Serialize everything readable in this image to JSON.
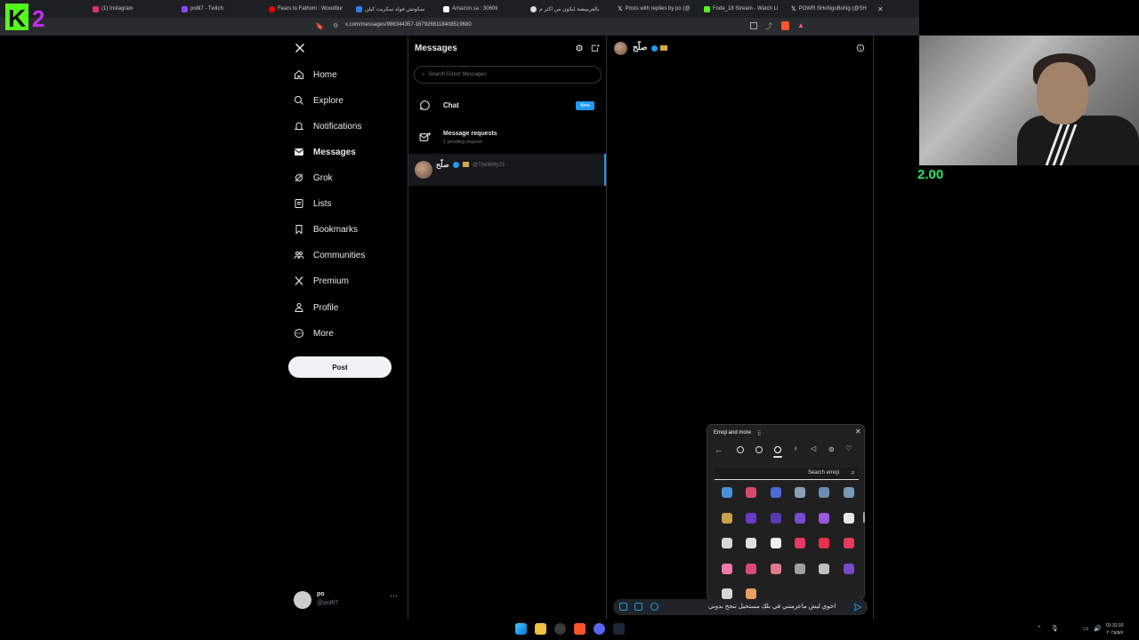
{
  "browser": {
    "tabs": [
      {
        "label": "instagra",
        "icon": "kick-icon"
      },
      {
        "label": "(1) Instagram",
        "icon": "instagram-icon"
      },
      {
        "label": "po8l7 - Twitch",
        "icon": "twitch-icon"
      },
      {
        "label": "Fears to Fathom : Woodbur",
        "icon": "youtube-icon"
      },
      {
        "label": "سكوتش فولد سكريت كيلن",
        "icon": "store-icon"
      },
      {
        "label": "Amazon.sa : 3060ti",
        "icon": "amazon-icon"
      },
      {
        "label": "بالعربيبضة لنكون من اكثر م",
        "icon": "google-icon"
      },
      {
        "label": "Posts with replies by po (@",
        "icon": "x-icon"
      },
      {
        "label": "Fode_18 Stream - Watch Li",
        "icon": "kick-icon"
      },
      {
        "label": "POWR SHoNgoBoNg (@SH",
        "icon": "x-icon"
      }
    ],
    "url": "x.com/messages/986344357-1679266118408519680"
  },
  "overlay": {
    "number": "2.00",
    "color": "#2ee36a"
  },
  "nav": {
    "items": [
      {
        "label": "Home",
        "icon": "home-icon"
      },
      {
        "label": "Explore",
        "icon": "search-icon"
      },
      {
        "label": "Notifications",
        "icon": "bell-icon"
      },
      {
        "label": "Messages",
        "icon": "envelope-icon",
        "active": true
      },
      {
        "label": "Grok",
        "icon": "grok-icon"
      },
      {
        "label": "Lists",
        "icon": "list-icon"
      },
      {
        "label": "Bookmarks",
        "icon": "bookmark-icon"
      },
      {
        "label": "Communities",
        "icon": "communities-icon"
      },
      {
        "label": "Premium",
        "icon": "x-icon"
      },
      {
        "label": "Profile",
        "icon": "person-icon"
      },
      {
        "label": "More",
        "icon": "more-circle-icon"
      }
    ],
    "post_label": "Post"
  },
  "account": {
    "name": "po",
    "handle": "@po8l7"
  },
  "messages": {
    "title": "Messages",
    "search_placeholder": "Search Direct Messages",
    "chat_label": "Chat",
    "beta_label": "Beta",
    "requests_label": "Message requests",
    "requests_sub": "1 pending request",
    "conversation": {
      "name": "صلّح",
      "handle": "@TheWitty21 ·"
    }
  },
  "chat": {
    "header_name": "صلّح",
    "composer_text": "اخوي ليش ماعزمتني في بلك مستحيل تنجح بدوني"
  },
  "emoji_panel": {
    "title": "Emoji and more",
    "search_text": "Search emoji",
    "rows": [
      [
        "#4a90d9",
        "#d94a6a",
        "#4a6ad9",
        "#8aa0b8",
        "#6a8ab0",
        "#7a98b8"
      ],
      [
        "#c8a050",
        "#6a3ac8",
        "#5a3ab0",
        "#7a4ad0",
        "#9a5ae0",
        "#e8e8e8"
      ],
      [
        "#d8d8d8",
        "#e0e0e0",
        "#f0f0f0",
        "#e83a6a",
        "#e8304a",
        "#e83a5a"
      ],
      [
        "#f07ab0",
        "#d84a7a",
        "#e07a8a",
        "#a0a0a0",
        "#c0c0c0",
        "#7a4ac8"
      ],
      [
        "#d8d8d8",
        "#e8a060"
      ]
    ]
  },
  "clock": {
    "time": "01:31:10",
    "date": "٢٠٢٥/٥/٤"
  }
}
